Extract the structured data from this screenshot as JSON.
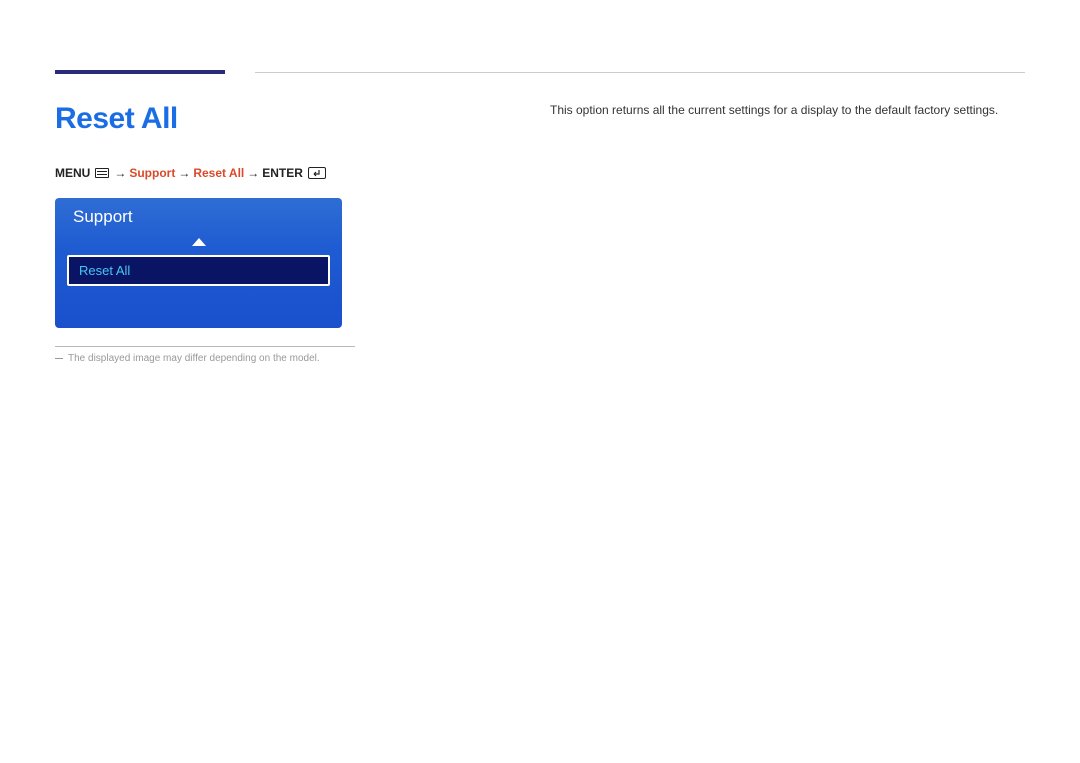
{
  "page_title": "Reset All",
  "breadcrumb": {
    "menu_label": "MENU",
    "arrow": "→",
    "support": "Support",
    "reset_all": "Reset All",
    "enter_label": "ENTER"
  },
  "osd": {
    "panel_title": "Support",
    "selected_item": "Reset All"
  },
  "footnote": "The displayed image may differ depending on the model.",
  "description": "This option returns all the current settings for a display to the default factory settings."
}
